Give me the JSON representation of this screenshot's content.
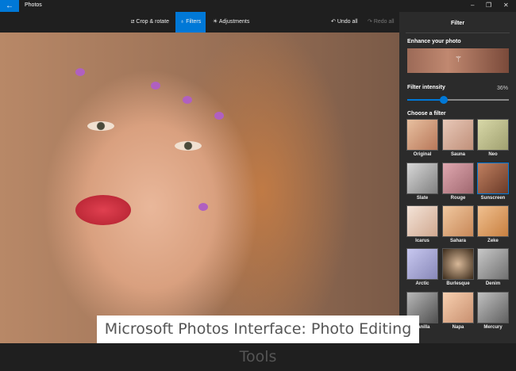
{
  "app": {
    "title": "Photos",
    "back": "←",
    "minimize": "–",
    "restore": "❐",
    "close": "✕"
  },
  "toolbar": {
    "crop": "Crop & rotate",
    "filters": "Filters",
    "adjustments": "Adjustments",
    "undo": "Undo all",
    "redo": "Redo all"
  },
  "panel": {
    "title": "Filter",
    "enhance": "Enhance your photo",
    "intensity_label": "Filter intensity",
    "intensity_text": "36%",
    "intensity": 36,
    "choose": "Choose a filter",
    "filters": [
      {
        "name": "Original",
        "bg": "linear-gradient(135deg,#e8c0a0,#b8785a)"
      },
      {
        "name": "Sauna",
        "bg": "linear-gradient(135deg,#e8c8b8,#c0907a)"
      },
      {
        "name": "Neo",
        "bg": "linear-gradient(135deg,#d8d8a8,#a0a070)"
      },
      {
        "name": "Slate",
        "bg": "linear-gradient(135deg,#d8d8d8,#808080)"
      },
      {
        "name": "Rouge",
        "bg": "linear-gradient(135deg,#e0a8b0,#a06870)"
      },
      {
        "name": "Sunscreen",
        "bg": "linear-gradient(135deg,#c08060,#6a3a28)"
      },
      {
        "name": "Icarus",
        "bg": "linear-gradient(135deg,#f4e4d8,#d0a890)"
      },
      {
        "name": "Sahara",
        "bg": "linear-gradient(135deg,#f0c8a0,#c88858)"
      },
      {
        "name": "Zeke",
        "bg": "linear-gradient(135deg,#f0c090,#c88040)"
      },
      {
        "name": "Arctic",
        "bg": "linear-gradient(135deg,#c8c8f0,#8888b8)"
      },
      {
        "name": "Burlesque",
        "bg": "radial-gradient(circle,#d8b898,#3a2a1a)"
      },
      {
        "name": "Denim",
        "bg": "linear-gradient(135deg,#c8c8c8,#707070)"
      },
      {
        "name": "Vanilla",
        "bg": "linear-gradient(135deg,#b8b8b8,#505050)"
      },
      {
        "name": "Napa",
        "bg": "linear-gradient(135deg,#f8d0b0,#c89070)"
      },
      {
        "name": "Mercury",
        "bg": "linear-gradient(135deg,#c0c0c0,#606060)"
      }
    ],
    "selected": "Sunscreen"
  },
  "caption": "Microsoft Photos Interface: Photo Editing Tools"
}
